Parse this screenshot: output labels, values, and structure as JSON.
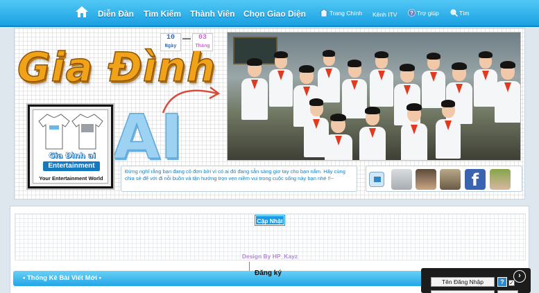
{
  "nav": {
    "main": [
      "Diễn Đàn",
      "Tìm Kiếm",
      "Thành Viên",
      "Chọn Giao Diện"
    ],
    "small": [
      "Trang Chính",
      "Kênh ITV",
      "Trợ giúp",
      "Tìm"
    ]
  },
  "header": {
    "logo_line1": "Gia Đình",
    "logo_line2": "AI",
    "date_day": "10",
    "date_day_label": "Ngày",
    "date_month": "03",
    "date_month_label": "Tháng"
  },
  "logo_card": {
    "title": "Gia Đình ai",
    "subtitle": "Entertainment",
    "tagline": "Your Entertainment World"
  },
  "quote": "Đừng nghĩ rằng bạn đang cô đơn bởi vì có ai đó đang sẵn sàng giơ tay cho bạn nắm. Hãy cùng chia sẻ để với đi nỗi buồn và tận hưởng trọn vẹn niềm vui trong cuộc sống này bạn nhé !!~",
  "social": {
    "facebook_glyph": "f"
  },
  "content": {
    "update_button": "Cập Nhật",
    "design_by": "Design By HP_Kayz",
    "stats_title": "• Thống Kê Bài Viết Mới •",
    "register": "Đăng ký"
  },
  "login": {
    "username_placeholder": "Tên Đăng Nhập",
    "help": "?",
    "next": "›"
  },
  "colors": {
    "nav_top": "#52c8f5",
    "nav_bottom": "#1aa0e2",
    "accent": "#1b9ae2",
    "logo_orange": "#f0a318"
  }
}
